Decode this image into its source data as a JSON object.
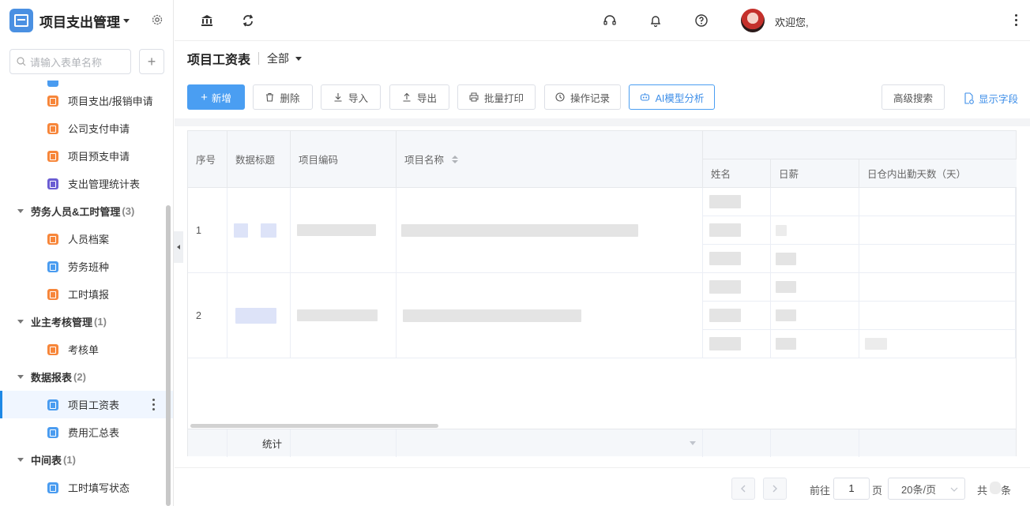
{
  "app": {
    "title": "项目支出管理"
  },
  "sidebar": {
    "search_placeholder": "请输入表单名称",
    "add_label": "+",
    "items": [
      {
        "label": "项目支出/报销申请",
        "color": "#f7863a"
      },
      {
        "label": "公司支付申请",
        "color": "#f7863a"
      },
      {
        "label": "项目预支申请",
        "color": "#f7863a"
      },
      {
        "label": "支出管理统计表",
        "color": "#6b5dd3"
      }
    ],
    "groups": [
      {
        "label": "劳务人员&工时管理",
        "count": "(3)",
        "items": [
          "人员档案",
          "劳务班种",
          "工时填报"
        ]
      },
      {
        "label": "业主考核管理",
        "count": "(1)",
        "items": [
          "考核单"
        ]
      },
      {
        "label": "数据报表",
        "count": "(2)",
        "items": [
          "项目工资表",
          "费用汇总表"
        ]
      },
      {
        "label": "中间表",
        "count": "(1)",
        "items": [
          "工时填写状态"
        ]
      }
    ]
  },
  "topbar": {
    "welcome": "欢迎您,"
  },
  "page": {
    "title": "项目工资表",
    "view": "全部"
  },
  "toolbar": {
    "add": "新增",
    "delete": "删除",
    "import": "导入",
    "export": "导出",
    "print": "批量打印",
    "log": "操作记录",
    "ai": "AI模型分析",
    "advanced_search": "高级搜索",
    "show_fields": "显示字段"
  },
  "table": {
    "headers": {
      "index": "序号",
      "data_title": "数据标题",
      "project_code": "项目编码",
      "project_name": "项目名称",
      "name": "姓名",
      "daily_wage": "日薪",
      "days": "日仓内出勤天数（天）"
    },
    "rows": [
      {
        "index": "1"
      },
      {
        "index": "2"
      }
    ],
    "summary_label": "统计"
  },
  "pagination": {
    "goto": "前往",
    "page_value": "1",
    "page_unit": "页",
    "page_size": "20条/页",
    "total_prefix": "共",
    "total_suffix": "条"
  },
  "colors": {
    "accent": "#4a9ef2",
    "active_bar": "#1e88e5"
  }
}
